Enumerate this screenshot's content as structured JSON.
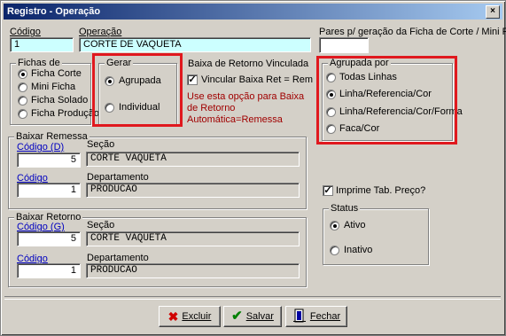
{
  "window": {
    "title": "Registro - Operação",
    "close_glyph": "×"
  },
  "codigo": {
    "label": "Código",
    "value": "1"
  },
  "operacao": {
    "label": "Operação",
    "value": "CORTE DE VAQUETA"
  },
  "pares": {
    "label": "Pares p/ geração da Ficha de Corte / Mini Ficha",
    "value": ""
  },
  "fichas_de": {
    "title": "Fichas de",
    "options": [
      {
        "label": "Ficha Corte",
        "selected": true
      },
      {
        "label": "Mini Ficha",
        "selected": false
      },
      {
        "label": "Ficha Solado",
        "selected": false
      },
      {
        "label": "Ficha Produção",
        "selected": false
      }
    ]
  },
  "gerar": {
    "title": "Gerar",
    "options": [
      {
        "label": "Agrupada",
        "selected": true
      },
      {
        "label": "Individual",
        "selected": false
      }
    ]
  },
  "baixa_retorno": {
    "title": "Baixa de Retorno Vinculada",
    "checkbox_label": "Vincular Baixa Ret = Rem",
    "checked": true,
    "note": "Use esta opção para Baixa de Retorno Automática=Remessa"
  },
  "agrupada_por": {
    "title": "Agrupada por",
    "options": [
      {
        "label": "Todas Linhas",
        "selected": false
      },
      {
        "label": "Linha/Referencia/Cor",
        "selected": true
      },
      {
        "label": "Linha/Referencia/Cor/Forma",
        "selected": false
      },
      {
        "label": "Faca/Cor",
        "selected": false
      }
    ]
  },
  "baixar_remessa": {
    "title": "Baixar Remessa",
    "codigo_link": "Código (D)",
    "codigo_value": "5",
    "secao_label": "Seção",
    "secao_value": "CORTE VAQUETA",
    "codigo2_link": "Código",
    "codigo2_value": "1",
    "depto_label": "Departamento",
    "depto_value": "PRODUCAO"
  },
  "baixar_retorno": {
    "title": "Baixar Retorno",
    "codigo_link": "Código (G)",
    "codigo_value": "5",
    "secao_label": "Seção",
    "secao_value": "CORTE VAQUETA",
    "codigo2_link": "Código",
    "codigo2_value": "1",
    "depto_label": "Departamento",
    "depto_value": "PRODUCAO"
  },
  "imprime": {
    "label": "Imprime Tab. Preço?",
    "checked": true
  },
  "status": {
    "title": "Status",
    "options": [
      {
        "label": "Ativo",
        "selected": true
      },
      {
        "label": "Inativo",
        "selected": false
      }
    ]
  },
  "buttons": {
    "excluir": "Excluir",
    "salvar": "Salvar",
    "fechar": "Fechar"
  },
  "colors": {
    "highlight": "#e0181e",
    "title_bar": "#0a246a",
    "note_text": "#a00000"
  }
}
